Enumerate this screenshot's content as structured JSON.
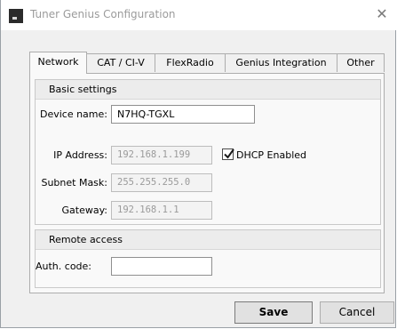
{
  "window": {
    "title": "Tuner Genius Configuration"
  },
  "tabs": [
    {
      "label": "Network"
    },
    {
      "label": "CAT / CI-V"
    },
    {
      "label": "FlexRadio"
    },
    {
      "label": "Genius Integration"
    },
    {
      "label": "Other"
    }
  ],
  "active_tab": "Network",
  "basic_settings": {
    "heading": "Basic settings",
    "device_name_label": "Device name:",
    "device_name_value": "N7HQ-TGXL",
    "ip_label": "IP Address:",
    "ip_value": "192.168.1.199",
    "dhcp_label": "DHCP Enabled",
    "dhcp_checked": true,
    "mask_label": "Subnet Mask:",
    "mask_value": "255.255.255.0",
    "gateway_label": "Gateway:",
    "gateway_value": "192.168.1.1"
  },
  "remote_access": {
    "heading": "Remote access",
    "auth_label": "Auth. code:",
    "auth_value": ""
  },
  "buttons": {
    "save": "Save",
    "cancel": "Cancel"
  },
  "icons": {
    "app": "tuner-genius-app-icon",
    "close": "close-icon",
    "check": "checkmark-icon"
  }
}
